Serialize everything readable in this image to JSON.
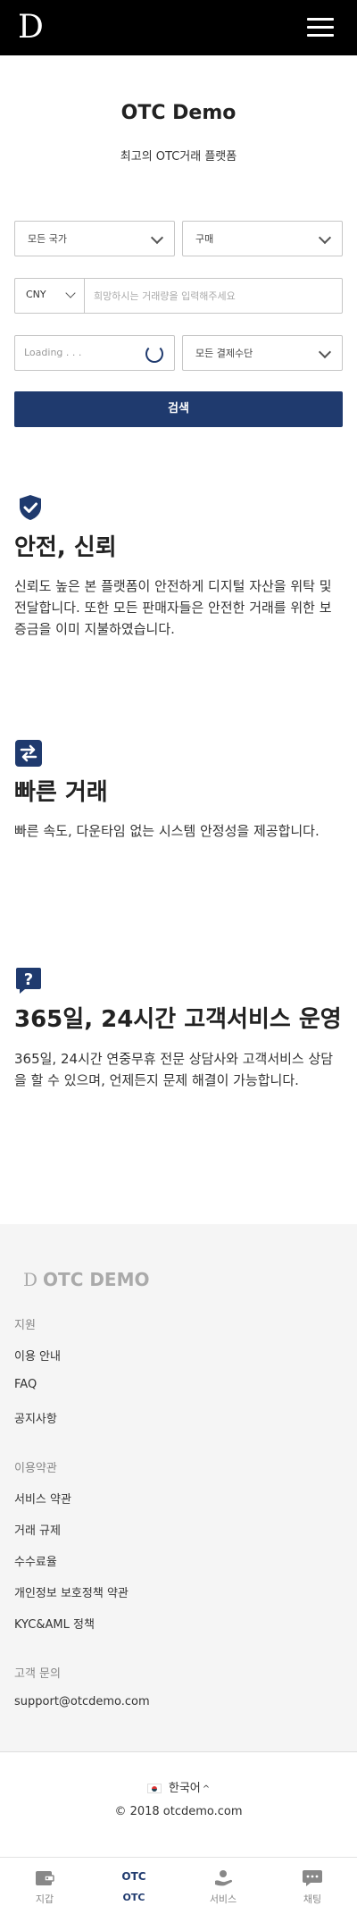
{
  "header": {
    "logo": "D"
  },
  "hero": {
    "title": "OTC Demo",
    "subtitle": "최고의 OTC거래 플랫폼"
  },
  "form": {
    "country": "모든 국가",
    "trade_type": "구매",
    "currency": "CNY",
    "amount_placeholder": "희망하시는 거래량을 입력해주세요",
    "loading": "Loading . . .",
    "payment": "모든 결제수단",
    "search_label": "검색"
  },
  "features": [
    {
      "title": "안전, 신뢰",
      "desc": "신뢰도 높은 본 플랫폼이 안전하게 디지털 자산을 위탁 및 전달합니다. 또한 모든 판매자들은 안전한 거래를 위한 보증금을 이미 지불하였습니다."
    },
    {
      "title": "빠른 거래",
      "desc": "빠른 속도, 다운타임 없는 시스템 안정성을 제공합니다."
    },
    {
      "title": "365일, 24시간 고객서비스 운영",
      "desc": "365일, 24시간 연중무휴 전문 상담사와 고객서비스 상담을 할 수 있으며, 언제든지 문제 해결이 가능합니다."
    }
  ],
  "footer": {
    "logo_mark": "D",
    "logo_text": "OTC DEMO",
    "support": {
      "heading": "지원",
      "links": [
        "이용 안내",
        "FAQ",
        "공지사항"
      ]
    },
    "terms": {
      "heading": "이용약관",
      "links": [
        "서비스 약관",
        "거래 규제",
        "수수료율",
        "개인정보 보호정책 약관",
        "KYC&AML 정책"
      ]
    },
    "contact": {
      "heading": "고객 문의",
      "email": "support@otcdemo.com"
    },
    "language": "한국어",
    "copyright": "© 2018 otcdemo.com"
  },
  "bottom_nav": [
    {
      "label": "지갑",
      "icon": "wallet-icon"
    },
    {
      "label": "OTC",
      "badge": "OTC",
      "icon": "otc-icon"
    },
    {
      "label": "서비스",
      "icon": "service-icon"
    },
    {
      "label": "채팅",
      "icon": "chat-icon"
    }
  ],
  "colors": {
    "accent": "#1f3a6e",
    "header_bg": "#000000"
  }
}
